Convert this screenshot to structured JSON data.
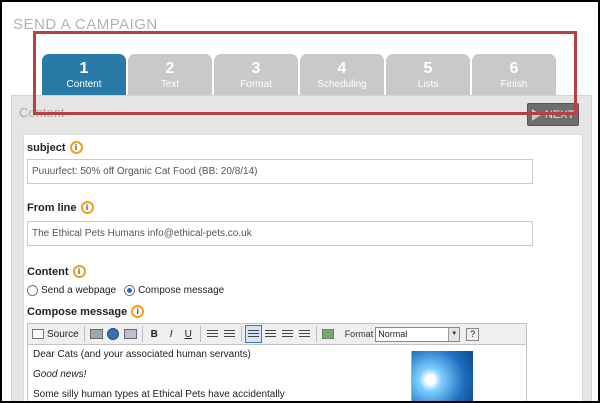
{
  "page": {
    "title": "SEND A CAMPAIGN"
  },
  "tabs": [
    {
      "num": "1",
      "label": "Content"
    },
    {
      "num": "2",
      "label": "Text"
    },
    {
      "num": "3",
      "label": "Format"
    },
    {
      "num": "4",
      "label": "Scheduling"
    },
    {
      "num": "5",
      "label": "Lists"
    },
    {
      "num": "6",
      "label": "Finish"
    }
  ],
  "active_tab": "1",
  "panel": {
    "title": "Content",
    "next_label": "NEXT"
  },
  "form": {
    "subject_label": "subject",
    "subject_value": "Puuurfect: 50% off Organic Cat Food (BB: 20/8/14)",
    "from_label": "From line",
    "from_value": "The Ethical Pets Humans info@ethical-pets.co.uk",
    "content_label": "Content",
    "option_webpage": "Send a webpage",
    "option_compose": "Compose message",
    "compose_label": "Compose message"
  },
  "toolbar": {
    "source_label": "Source",
    "bold": "B",
    "italic": "I",
    "underline": "U",
    "format_label": "Format",
    "format_value": "Normal",
    "help": "?"
  },
  "editor": {
    "line1": "Dear Cats (and your associated human servants)",
    "line2": "Good news!",
    "line3": "Some silly human types at Ethical Pets have accidentally"
  },
  "colors": {
    "active_tab": "#2a7aa8",
    "inactive_tab": "#c9c9c9",
    "highlight": "#b84040",
    "info_ring": "#f0a018"
  }
}
